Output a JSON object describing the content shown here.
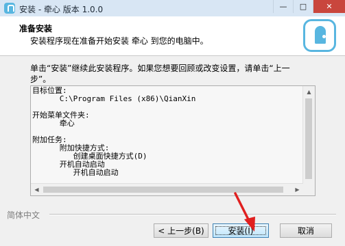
{
  "window": {
    "title": "安装 - 牵心 版本 1.0.0",
    "icon": "app-icon",
    "controls": [
      "minimize-icon",
      "maximize-icon",
      "close-icon"
    ]
  },
  "header": {
    "title": "准备安装",
    "subtitle": "安装程序现在准备开始安装  牵心 到您的电脑中。",
    "logo": "brand-logo"
  },
  "intro": "单击“安装”继续此安装程序。如果您想要回顾或改变设置，请单击“上一步”。",
  "summary": {
    "lines": [
      "目标位置:",
      "      C:\\Program Files (x86)\\QianXin",
      "",
      "开始菜单文件夹:",
      "      牵心",
      "",
      "附加任务:",
      "      附加快捷方式:",
      "         创建桌面快捷方式(D)",
      "      开机自动启动",
      "         开机自动启动"
    ]
  },
  "footer": {
    "language": "简体中文",
    "back_button": "< 上一步(B)",
    "install_button": "安装(I)",
    "cancel_button": "取消"
  },
  "colors": {
    "accent": "#58b6e0",
    "arrow": "#e02020"
  }
}
